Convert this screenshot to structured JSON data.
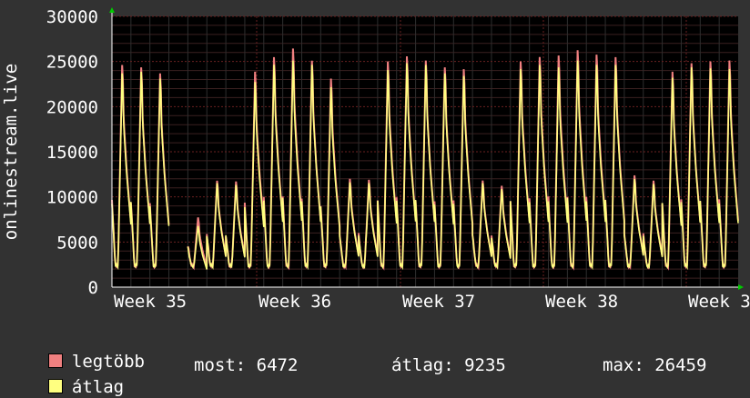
{
  "chart_data": {
    "type": "line",
    "ylabel": "onlinestream.live",
    "y_ticks": [
      "0",
      "5000",
      "10000",
      "15000",
      "20000",
      "25000",
      "30000"
    ],
    "ylim": [
      0,
      30000
    ],
    "x_ticks": [
      "Week 35",
      "Week 36",
      "Week 37",
      "Week 38",
      "Week 3"
    ],
    "grid": true,
    "colors": {
      "max": "#f08080",
      "avg": "#ffff80",
      "background": "#000000",
      "grid": "#5a1a1a"
    },
    "series": [
      {
        "name": "legtöbb",
        "color": "#f08080",
        "daily_peaks": [
          25800,
          25500,
          24800,
          null,
          8000,
          12300,
          12200,
          25000,
          26700,
          27700,
          26300,
          24200,
          12500,
          12400,
          26200,
          26800,
          26300,
          25500,
          25300,
          12300,
          11700,
          26200,
          26700,
          26900,
          27500,
          27000,
          26700,
          12900,
          12300,
          25000,
          26000,
          26200,
          26300
        ]
      },
      {
        "name": "átlag",
        "color": "#ffff80",
        "daily_peaks": [
          24800,
          25000,
          24200,
          null,
          7000,
          12000,
          11800,
          23800,
          25800,
          26300,
          25800,
          23200,
          12100,
          12000,
          25200,
          26000,
          25800,
          24800,
          24500,
          12000,
          11300,
          25300,
          25800,
          25500,
          26300,
          25800,
          25800,
          12500,
          11900,
          24300,
          25500,
          25400,
          25300
        ]
      }
    ]
  },
  "legend": {
    "max_label": "legtöbb",
    "avg_label": "átlag"
  },
  "stats": {
    "current": "most: 6472",
    "average": "átlag: 9235",
    "maximum": "max: 26459"
  }
}
